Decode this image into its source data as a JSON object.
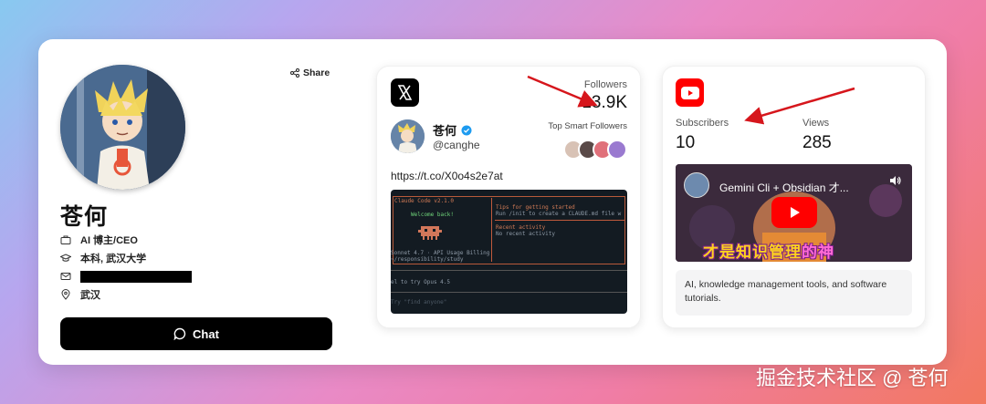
{
  "profile": {
    "name": "苍何",
    "share_label": "Share",
    "title": "AI 博主/CEO",
    "education": "本科, 武汉大学",
    "location": "武汉",
    "chat_label": "Chat"
  },
  "x_card": {
    "followers_label": "Followers",
    "followers_value": "13.9K",
    "display_name": "苍何",
    "handle": "@canghe",
    "top_smart_label": "Top Smart Followers",
    "link": "https://t.co/X0o4s2e7at",
    "terminal": {
      "header": "Claude Code v2.1.0",
      "welcome": "Welcome back!",
      "tips_title": "Tips for getting started",
      "tips_line": "Run /init to create a CLAUDE.md file w",
      "recent_title": "Recent activity",
      "recent_line": "No recent activity",
      "model_line": "Sonnet 4.7 · API Usage Billing",
      "path_line": "~/responsibility/study",
      "try_line": "el to try Opus 4.5",
      "prompt_line": "Try \"find anyone\""
    }
  },
  "yt_card": {
    "subscribers_label": "Subscribers",
    "subscribers_value": "10",
    "views_label": "Views",
    "views_value": "285",
    "video_title": "Gemini Cli + Obsidian 才...",
    "video_caption_a": "才是知识管理",
    "video_caption_b": "的神",
    "description": "AI, knowledge management tools, and software tutorials."
  },
  "colors": {
    "x_brand": "#000000",
    "youtube_red": "#ff0000",
    "verified_blue": "#1d9bf0",
    "arrow_red": "#d6161c"
  },
  "icons": [
    "share-icon",
    "briefcase-icon",
    "graduation-cap-icon",
    "mail-icon",
    "location-pin-icon",
    "chat-bubble-icon",
    "x-logo-icon",
    "youtube-logo-icon",
    "verified-badge-icon",
    "play-icon",
    "volume-icon"
  ],
  "watermark": "掘金技术社区 @ 苍何"
}
